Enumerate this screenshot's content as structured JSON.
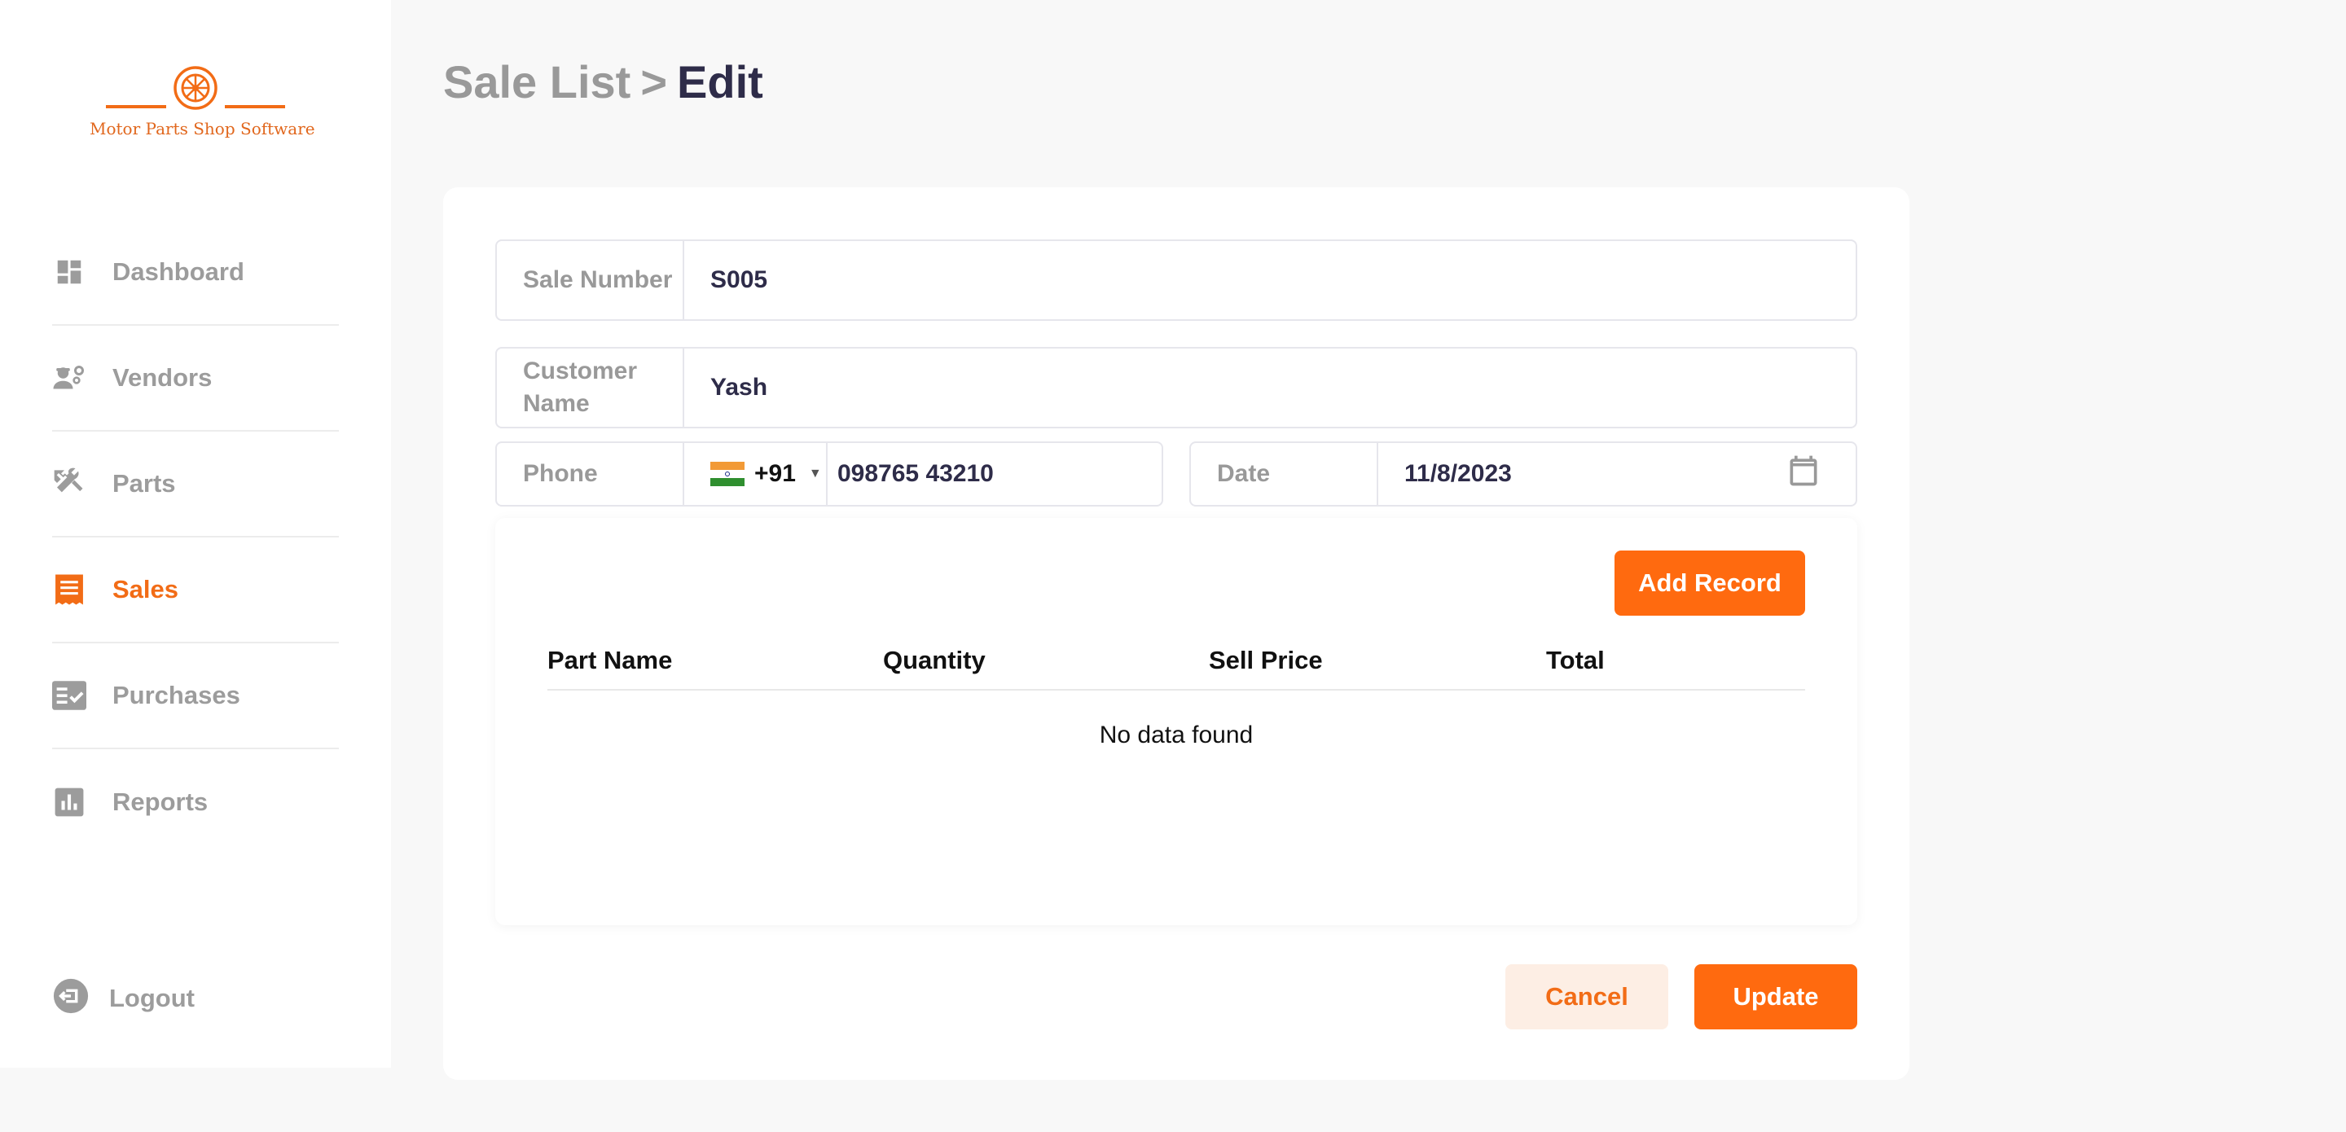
{
  "app": {
    "logo_text": "Motor Parts Shop Software"
  },
  "sidebar": {
    "items": [
      {
        "label": "Dashboard",
        "icon": "dashboard-icon",
        "active": false
      },
      {
        "label": "Vendors",
        "icon": "vendors-icon",
        "active": false
      },
      {
        "label": "Parts",
        "icon": "tools-icon",
        "active": false
      },
      {
        "label": "Sales",
        "icon": "receipt-icon",
        "active": true
      },
      {
        "label": "Purchases",
        "icon": "checklist-icon",
        "active": false
      },
      {
        "label": "Reports",
        "icon": "bar-chart-icon",
        "active": false
      }
    ],
    "logout_label": "Logout"
  },
  "breadcrumb": {
    "parent": "Sale List",
    "separator": ">",
    "current": "Edit"
  },
  "form": {
    "sale_number_label": "Sale Number",
    "sale_number_value": "S005",
    "customer_name_label": "Customer Name",
    "customer_name_value": "Yash",
    "phone_label": "Phone",
    "phone_country_code": "+91",
    "phone_value": "098765 43210",
    "date_label": "Date",
    "date_value": "11/8/2023"
  },
  "records": {
    "add_button": "Add Record",
    "columns": [
      "Part Name",
      "Quantity",
      "Sell Price",
      "Total"
    ],
    "empty_message": "No data found"
  },
  "actions": {
    "cancel": "Cancel",
    "update": "Update"
  },
  "colors": {
    "accent": "#ff6a0f",
    "accent_light": "#fdeee4",
    "text_dark": "#2e2c49",
    "text_muted": "#999999"
  }
}
